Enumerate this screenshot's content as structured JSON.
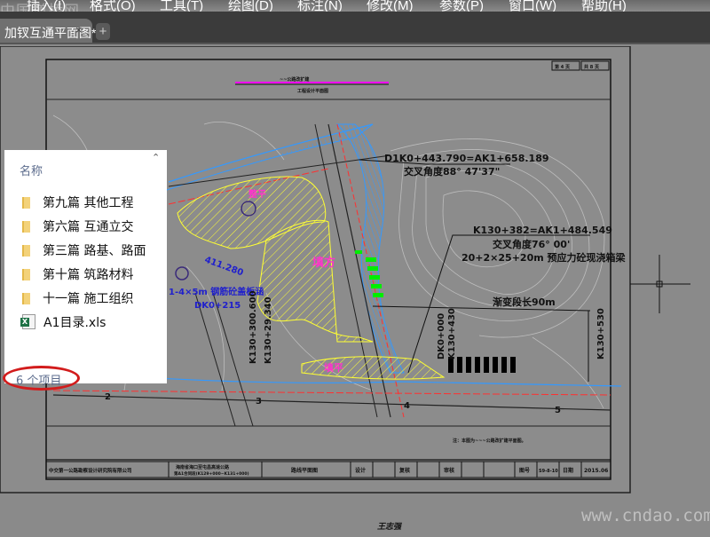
{
  "menubar": {
    "watermark": "中国道桥网",
    "items": [
      "插入(I)",
      "格式(O)",
      "工具(T)",
      "绘图(D)",
      "标注(N)",
      "修改(M)",
      "参数(P)",
      "窗口(W)",
      "帮助(H)"
    ]
  },
  "tabs": {
    "active": "加钗互通平面图*",
    "close": "×",
    "add": "+"
  },
  "drawing": {
    "header_title": "~~公路改扩建",
    "header_subtitle": "工程设计平面图",
    "page_current": "第 4 页",
    "page_total": "共 8 页",
    "annotations": {
      "cross1_station": "D1K0+443.790=AK1+658.189",
      "cross1_angle": "交叉角度88° 47'37\"",
      "cross2_station": "K130+382=AK1+484.549",
      "cross2_angle": "交叉角度76° 00'",
      "bridge": "20+2×25+20m 预应力砼现浇箱梁",
      "transition": "渐变段长90m",
      "culvert": "1-4×5m 钢筋砼盖板涵",
      "culvert_station": "DK0+215",
      "elevation": "411.280",
      "dk_start": "DK0+000",
      "k130_430": "K130+430",
      "k130_530": "K130+530",
      "k130_300": "K130+300.600",
      "k_29340": "K130+29.340",
      "fill_label": "填平",
      "fill_label2": "整平",
      "fill_label3": "填方",
      "stations": [
        "2",
        "3",
        "4",
        "5"
      ],
      "note": "注：本图为~~~公路改扩建平面图。"
    },
    "title_block": {
      "company": "中交第一公路勘察设计研究院有限公司",
      "project": "海南省海口至屯昌高速公路",
      "project_sub": "第A1合同段(K129+000~K131+000)",
      "drawing_name": "路线平面图",
      "design": "设计",
      "check": "复核",
      "review": "审核",
      "drawing_no_label": "图号",
      "drawing_no": "S9-8-10",
      "date_label": "日期",
      "date": "2015.06"
    },
    "signature": "王志强"
  },
  "popup": {
    "header": "名称",
    "items": [
      {
        "name": "第九篇 其他工程",
        "type": "folder"
      },
      {
        "name": "第六篇 互通立交",
        "type": "folder"
      },
      {
        "name": "第三篇 路基、路面",
        "type": "folder"
      },
      {
        "name": "第十篇 筑路材料",
        "type": "folder"
      },
      {
        "name": "十一篇 施工组织",
        "type": "folder"
      },
      {
        "name": "A1目录.xls",
        "type": "excel"
      }
    ],
    "count": "6 个项目"
  },
  "watermark": "www.cndao.com",
  "colors": {
    "annotation_circle": "#d21c1c",
    "hatch": "#ffff33",
    "road": "#3399ff",
    "magenta": "#ff33cc",
    "green": "#00ee00"
  }
}
